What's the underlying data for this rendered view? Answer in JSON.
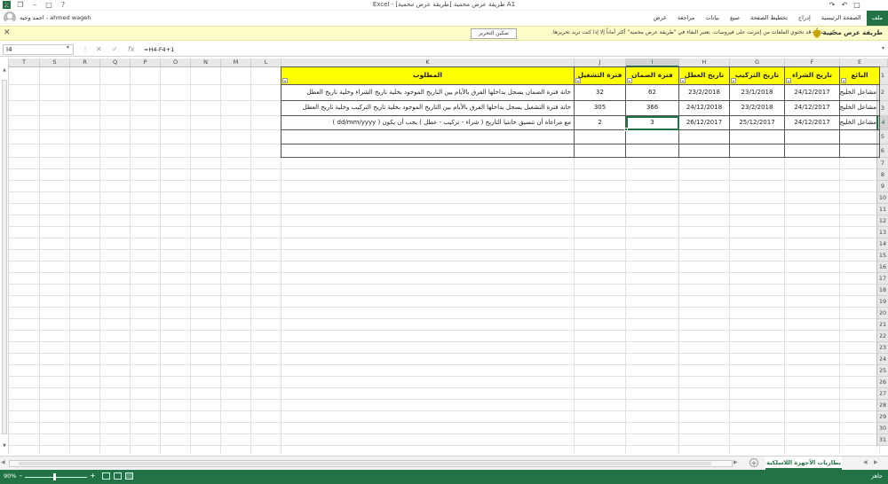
{
  "window": {
    "title": "Excel - [طريقة عرض محمية] طريقة عرض محمية  A1",
    "user": "احمد وجيه - ahmed wageh"
  },
  "ribbon_tabs": [
    {
      "label": "ملف",
      "active": true
    },
    {
      "label": "الصفحة الرئيسية"
    },
    {
      "label": "إدراج"
    },
    {
      "label": "تخطيط الصفحة"
    },
    {
      "label": "صيغ"
    },
    {
      "label": "بيانات"
    },
    {
      "label": "مراجعة"
    },
    {
      "label": "عرض"
    }
  ],
  "protected_bar": {
    "title": "طريقة عرض محمية",
    "message": "كن حذراً—قد تحتوي الملفات من إنترنت على فيروسات. يعتبر البقاء في \"طريقة عرض محمية\" أكثر أماناً إلا إذا كنت تريد تحريرها.",
    "enable_label": "تمكين التحرير",
    "close_icon": "close-icon"
  },
  "formula_bar": {
    "name_box": "I4",
    "formula": "=H4-F4+1",
    "icons": [
      "cancel-icon",
      "enter-icon",
      "function-icon"
    ]
  },
  "columns": [
    "T",
    "S",
    "R",
    "Q",
    "P",
    "O",
    "N",
    "M",
    "L",
    "K",
    "J",
    "I",
    "H",
    "G",
    "F",
    "E"
  ],
  "selected_column": "I",
  "rows": [
    "1",
    "2",
    "3",
    "4",
    "5",
    "6",
    "7",
    "8",
    "9",
    "10",
    "11",
    "12",
    "13",
    "14",
    "15",
    "16",
    "17",
    "18",
    "19",
    "20",
    "21",
    "22",
    "23",
    "24",
    "25",
    "26",
    "27",
    "28",
    "29",
    "30",
    "31"
  ],
  "selected_row": "4",
  "table": {
    "headers": {
      "E": "البائع",
      "F": "تاريخ الشراء",
      "G": "تاريخ التركيب",
      "H": "تاريخ العطل",
      "I": "فترة الضمان",
      "J": "فترة التشغيل",
      "K": "المطلوب"
    },
    "rows": [
      {
        "E": "مشاعل الخليج",
        "F": "24/12/2017",
        "G": "23/1/2018",
        "H": "23/2/2018",
        "I": "62",
        "J": "32",
        "K": "خانة فترة الضمان يسجل بداخلها الفرق بالأيام بين التاريخ الموجود بخلية تاريخ الشراء وخلية تاريخ العطل"
      },
      {
        "E": "مشاعل الخليج",
        "F": "24/12/2017",
        "G": "23/2/2018",
        "H": "24/12/2018",
        "I": "366",
        "J": "305",
        "K": "خانة فترة التشغيل يسجل بداخلها الفرق بالأيام بين التاريخ الموجود بخلية تاريخ التركيب وخلية تاريخ العطل"
      },
      {
        "E": "مشاعل الخليج",
        "F": "24/12/2017",
        "G": "25/12/2017",
        "H": "26/12/2017",
        "I": "3",
        "J": "2",
        "K": "مع مراعاة أن تنسيق خانتيا التاريخ (  شراء  - تركيب - عطل  ) يجب أن يكون  ( dd/mm/yyyy )"
      }
    ]
  },
  "sheet_tabs": [
    {
      "label": "بطاريات الأجهزة اللاسلكية",
      "active": true
    }
  ],
  "status": {
    "ready": "جاهز",
    "zoom": "90%"
  }
}
